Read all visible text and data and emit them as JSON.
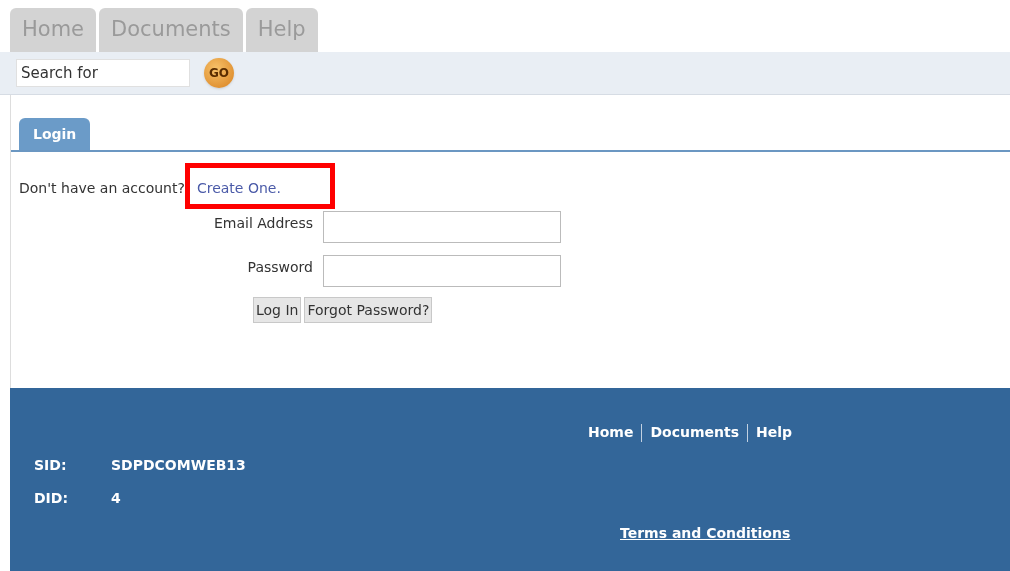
{
  "nav_tabs": [
    {
      "label": "Home"
    },
    {
      "label": "Documents"
    },
    {
      "label": "Help"
    }
  ],
  "search": {
    "value": "Search for",
    "button": "GO"
  },
  "panel_tabs": [
    {
      "label": "Login",
      "selected": true
    }
  ],
  "signup_prompt": {
    "text": "Don't have an account?",
    "link": "Create One.",
    "highlighted": true
  },
  "form": {
    "fields": [
      {
        "label": "Email Address"
      },
      {
        "label": "Password"
      }
    ],
    "buttons": [
      "Log In",
      "Forgot Password?"
    ]
  },
  "footer": {
    "links": [
      "Home",
      "Documents",
      "Help"
    ],
    "info": [
      {
        "label": "SID:",
        "value": "SDPDCOMWEB13"
      },
      {
        "label": "DID:",
        "value": "4"
      }
    ],
    "terms": "Terms and Conditions"
  }
}
